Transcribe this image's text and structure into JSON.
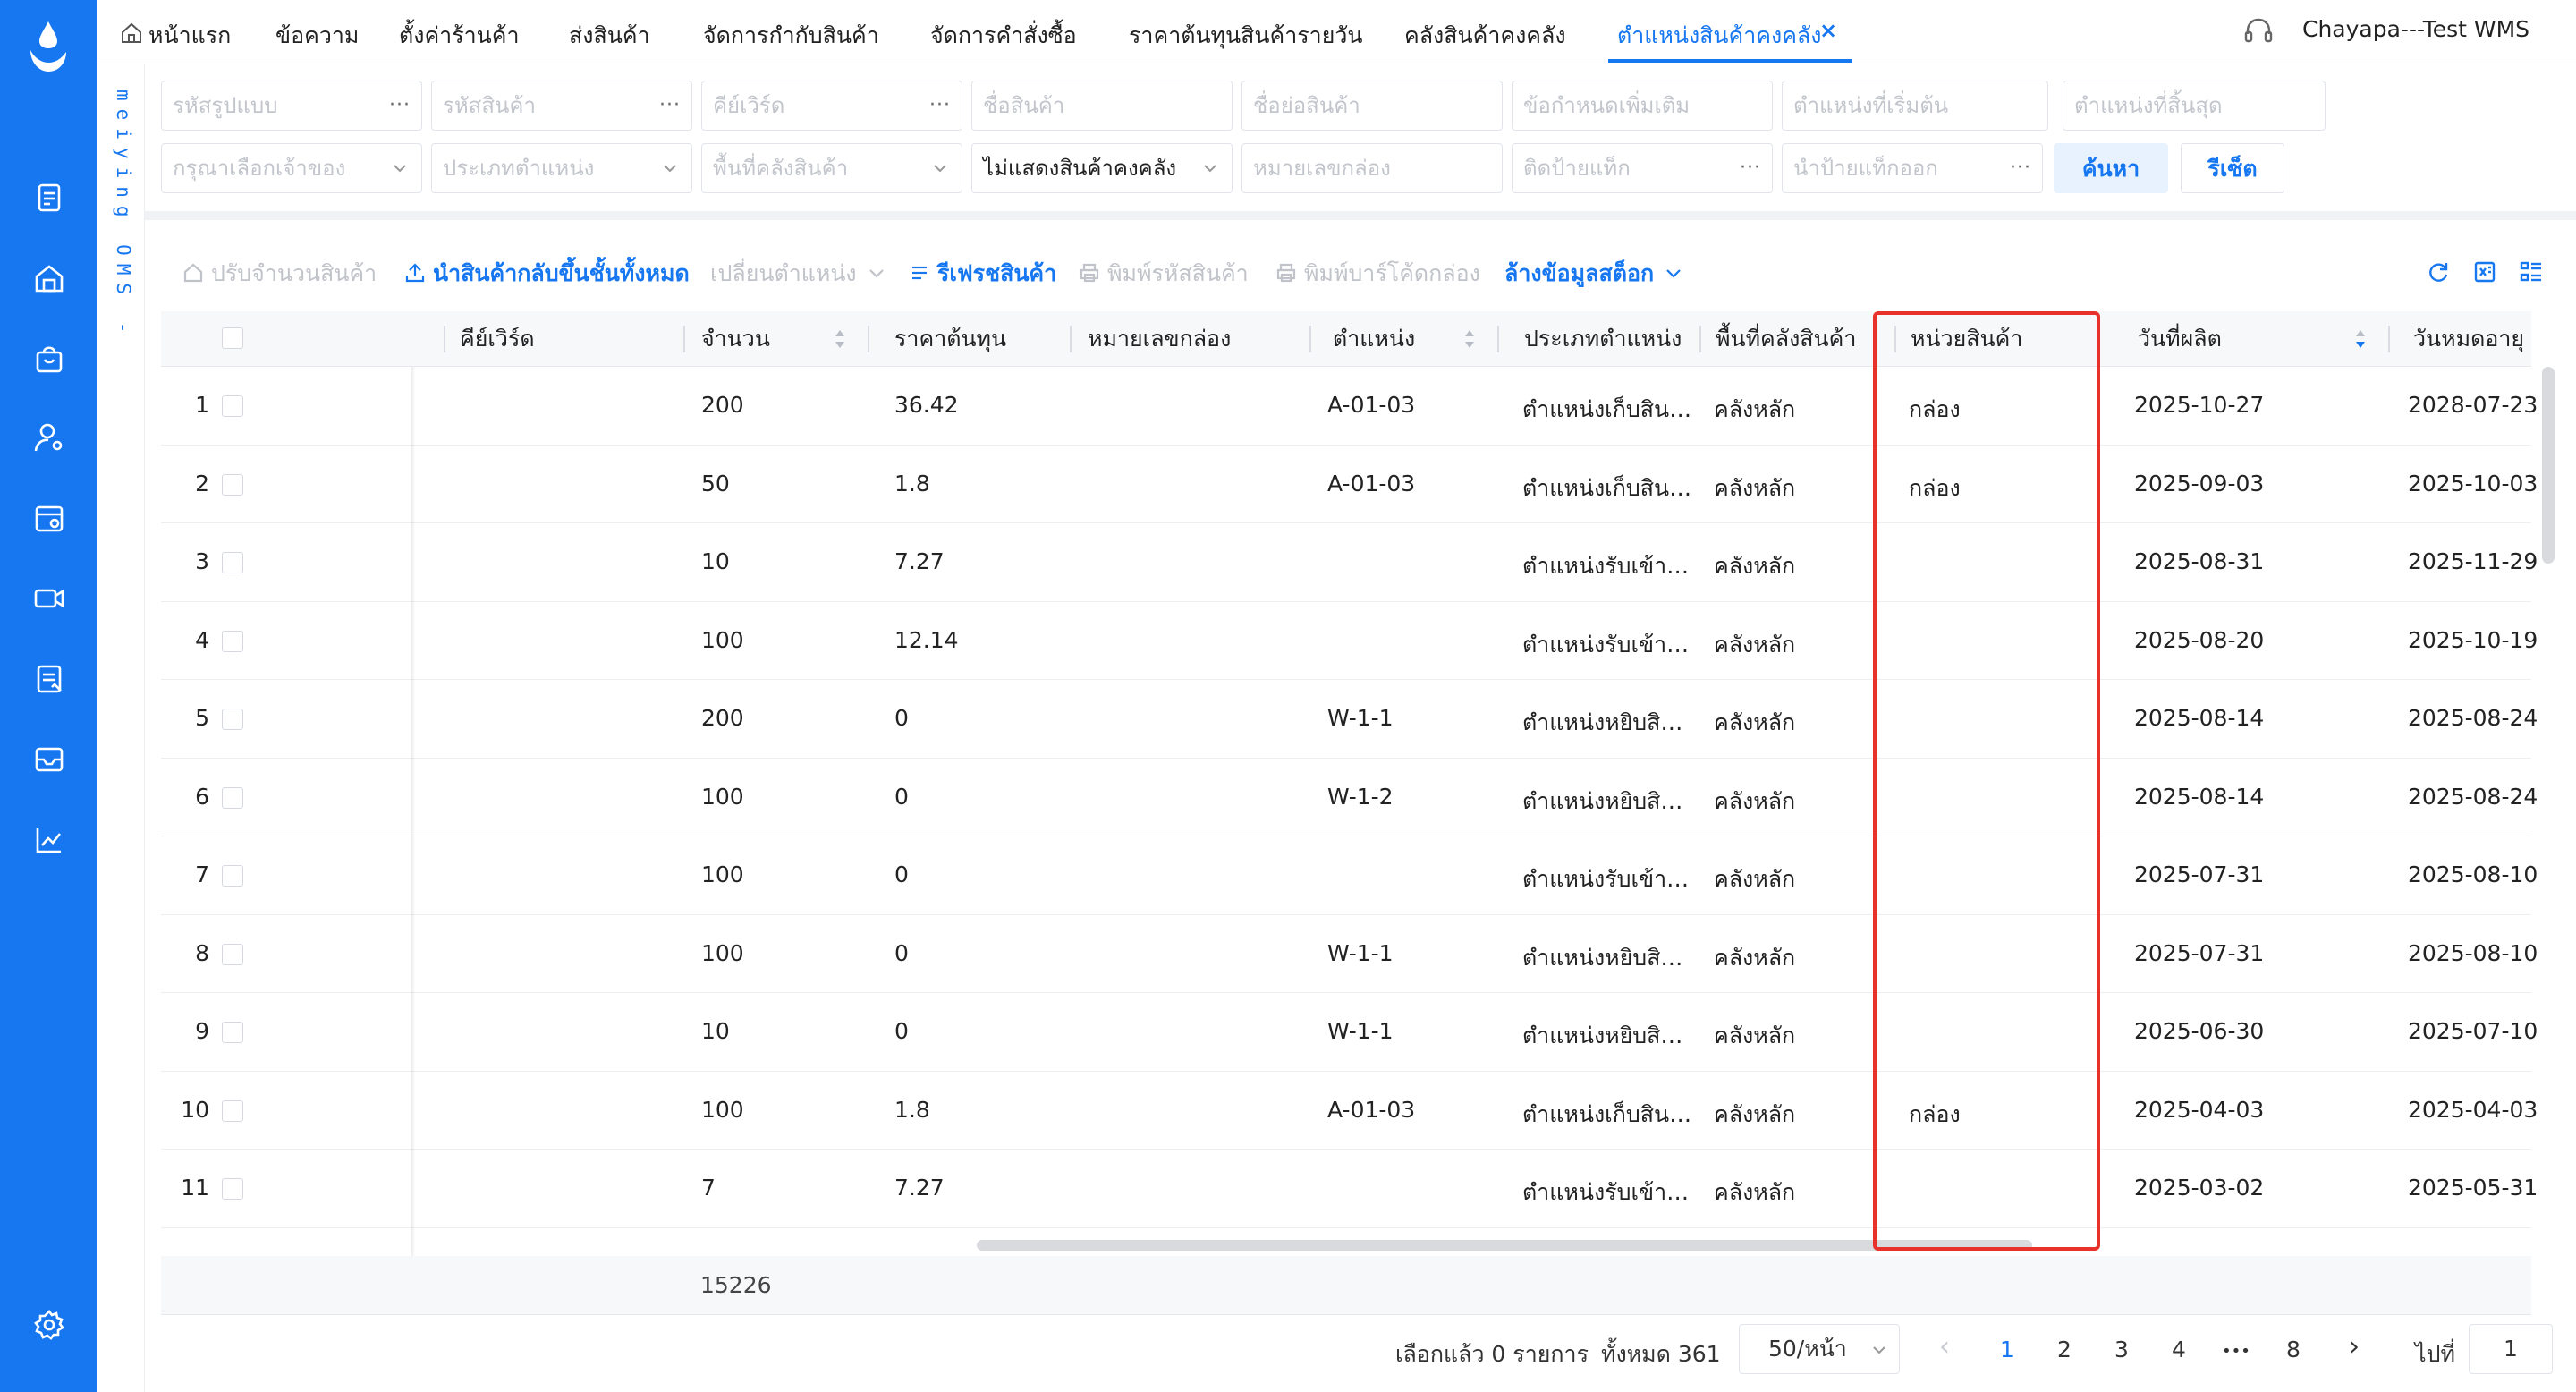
{
  "sidebar": {
    "logo": "droplet-logo",
    "icons": [
      "orders-icon",
      "warehouse-icon",
      "bag-icon",
      "user-settings-icon",
      "store-icon",
      "video-icon",
      "report-icon",
      "inbox-icon",
      "chart-icon",
      "settings-icon"
    ],
    "oms_label": "meiying OMS -"
  },
  "topbar": {
    "tabs": [
      "หน้าแรก",
      "ข้อความ",
      "ตั้งค่าร้านค้า",
      "ส่งสินค้า",
      "จัดการกำกับสินค้า",
      "จัดการคำสั่งซื้อ",
      "ราคาต้นทุนสินค้ารายวัน",
      "คลังสินค้าคงคลัง",
      "ตำแหน่งสินค้าคงคลัง"
    ],
    "close_mark": "×",
    "user": "Chayapa---Test WMS"
  },
  "filters": {
    "row1": [
      "รหัสรูปแบบ",
      "รหัสสินค้า",
      "คีย์เวิร์ด",
      "ชื่อสินค้า",
      "ชื่อย่อสินค้า",
      "ข้อกำหนดเพิ่มเติม",
      "ตำแหน่งที่เริ่มต้น",
      "ตำแหน่งที่สิ้นสุด"
    ],
    "row2": [
      "กรุณาเลือกเจ้าของ",
      "ประเภทตำแหน่ง",
      "พื้นที่คลังสินค้า",
      "ไม่แสดงสินค้าคงคลัง",
      "หมายเลขกล่อง",
      "ติดป้ายแท็ก",
      "นำป้ายแท็กออก"
    ],
    "dots": "···",
    "search_button": "ค้นหา",
    "reset_button": "รีเซ็ต"
  },
  "toolbar": {
    "adjust_qty": "ปรับจำนวนสินค้า",
    "return_all": "นำสินค้ากลับขึ้นชั้นทั้งหมด",
    "change_location": "เปลี่ยนตำแหน่ง",
    "refresh": "รีเฟรชสินค้า",
    "print_code": "พิมพ์รหัสสินค้า",
    "print_barcode": "พิมพ์บาร์โค้ดกล่อง",
    "clear_stock": "ล้างข้อมูลสต็อก"
  },
  "table": {
    "headers": [
      "คีย์เวิร์ด",
      "จำนวน",
      "ราคาต้นทุน",
      "หมายเลขกล่อง",
      "ตำแหน่ง",
      "ประเภทตำแหน่ง",
      "พื้นที่คลังสินค้า",
      "หน่วยสินค้า",
      "วันที่ผลิต",
      "วันหมดอายุ"
    ],
    "rows": [
      {
        "no": "1",
        "qty": "200",
        "cost": "36.42",
        "loc": "A-01-03",
        "type": "ตำแหน่งเก็บสิน…",
        "area": "คลังหลัก",
        "unit": "กล่อง",
        "mfg": "2025-10-27",
        "exp": "2028-07-23"
      },
      {
        "no": "2",
        "qty": "50",
        "cost": "1.8",
        "loc": "A-01-03",
        "type": "ตำแหน่งเก็บสิน…",
        "area": "คลังหลัก",
        "unit": "กล่อง",
        "mfg": "2025-09-03",
        "exp": "2025-10-03"
      },
      {
        "no": "3",
        "qty": "10",
        "cost": "7.27",
        "loc": "",
        "type": "ตำแหน่งรับเข้า…",
        "area": "คลังหลัก",
        "unit": "",
        "mfg": "2025-08-31",
        "exp": "2025-11-29"
      },
      {
        "no": "4",
        "qty": "100",
        "cost": "12.14",
        "loc": "",
        "type": "ตำแหน่งรับเข้า…",
        "area": "คลังหลัก",
        "unit": "",
        "mfg": "2025-08-20",
        "exp": "2025-10-19"
      },
      {
        "no": "5",
        "qty": "200",
        "cost": "0",
        "loc": "W-1-1",
        "type": "ตำแหน่งหยิบสิ…",
        "area": "คลังหลัก",
        "unit": "",
        "mfg": "2025-08-14",
        "exp": "2025-08-24"
      },
      {
        "no": "6",
        "qty": "100",
        "cost": "0",
        "loc": "W-1-2",
        "type": "ตำแหน่งหยิบสิ…",
        "area": "คลังหลัก",
        "unit": "",
        "mfg": "2025-08-14",
        "exp": "2025-08-24"
      },
      {
        "no": "7",
        "qty": "100",
        "cost": "0",
        "loc": "",
        "type": "ตำแหน่งรับเข้า…",
        "area": "คลังหลัก",
        "unit": "",
        "mfg": "2025-07-31",
        "exp": "2025-08-10"
      },
      {
        "no": "8",
        "qty": "100",
        "cost": "0",
        "loc": "W-1-1",
        "type": "ตำแหน่งหยิบสิ…",
        "area": "คลังหลัก",
        "unit": "",
        "mfg": "2025-07-31",
        "exp": "2025-08-10"
      },
      {
        "no": "9",
        "qty": "10",
        "cost": "0",
        "loc": "W-1-1",
        "type": "ตำแหน่งหยิบสิ…",
        "area": "คลังหลัก",
        "unit": "",
        "mfg": "2025-06-30",
        "exp": "2025-07-10"
      },
      {
        "no": "10",
        "qty": "100",
        "cost": "1.8",
        "loc": "A-01-03",
        "type": "ตำแหน่งเก็บสิน…",
        "area": "คลังหลัก",
        "unit": "กล่อง",
        "mfg": "2025-04-03",
        "exp": "2025-04-03"
      },
      {
        "no": "11",
        "qty": "7",
        "cost": "7.27",
        "loc": "",
        "type": "ตำแหน่งรับเข้า…",
        "area": "คลังหลัก",
        "unit": "",
        "mfg": "2025-03-02",
        "exp": "2025-05-31"
      }
    ],
    "sum_qty": "15226",
    "highlight_color": "#e8312a"
  },
  "pagination": {
    "selected": "เลือกแล้ว 0 รายการ",
    "total": "ทั้งหมด 361",
    "page_size": "50/หน้า",
    "pages": [
      "1",
      "2",
      "3",
      "4",
      "•••",
      "8"
    ],
    "prev": "‹",
    "next": "›",
    "goto_label": "ไปที่",
    "goto_value": "1"
  },
  "colors": {
    "accent": "#1677f0",
    "sidebar": "#1677f0",
    "highlight": "#e8312a"
  }
}
